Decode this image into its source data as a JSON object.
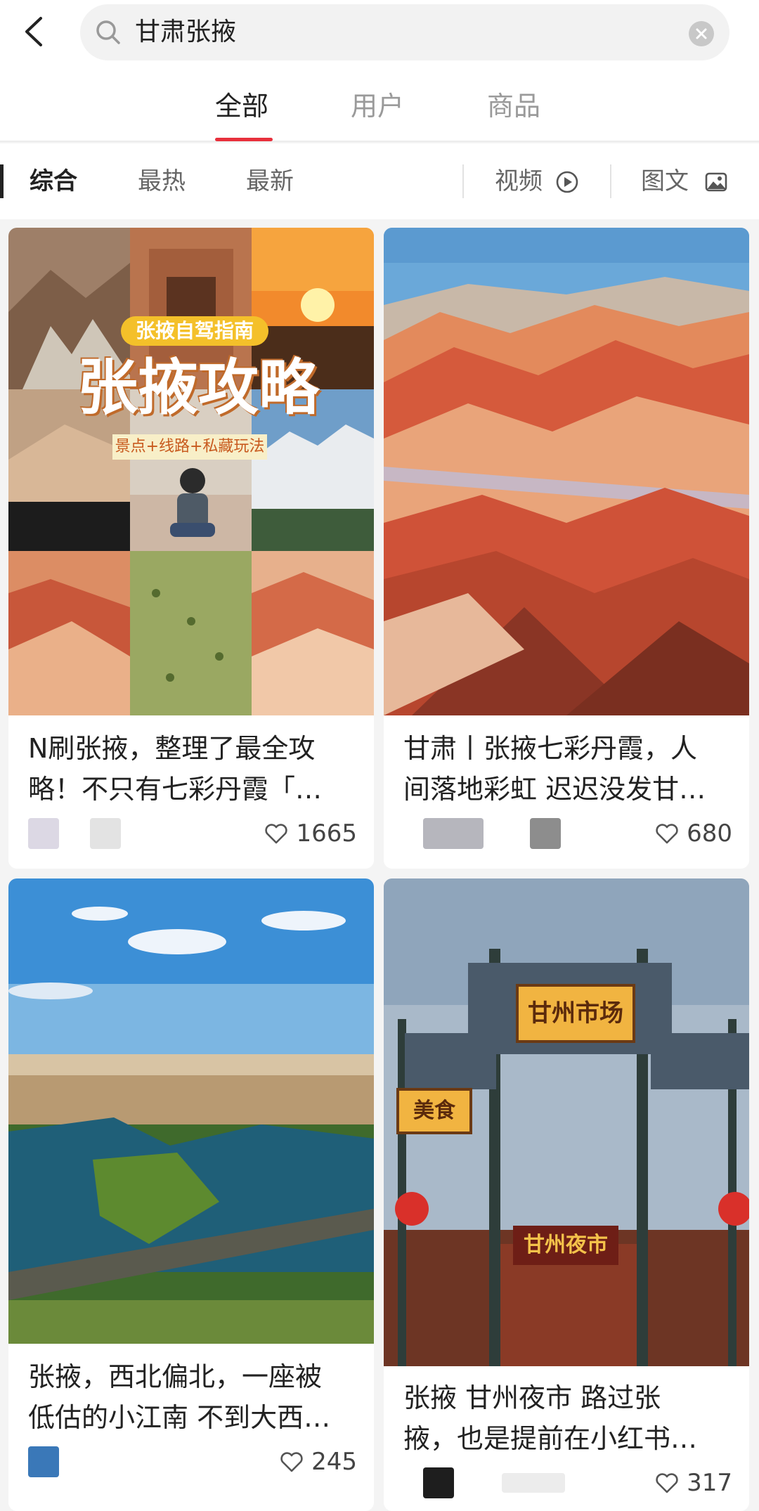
{
  "search": {
    "query": "甘肃张掖"
  },
  "tabs": [
    {
      "label": "全部"
    },
    {
      "label": "用户"
    },
    {
      "label": "商品"
    }
  ],
  "filters": {
    "items": [
      "综合",
      "最热",
      "最新"
    ],
    "video": "视频",
    "image_text": "图文"
  },
  "cards": [
    {
      "title_line1": "N刷张掖，整理了最全攻",
      "title_line2": "略！不只有七彩丹霞「…",
      "likes": "1665",
      "overlay_top": "张掖自驾指南",
      "overlay_main": "张掖攻略",
      "overlay_sub": "景点+线路+私藏玩法"
    },
    {
      "title_line1": "甘肃丨张掖七彩丹霞，人",
      "title_line2": "间落地彩虹 迟迟没发甘…",
      "likes": "680"
    },
    {
      "title_line1": "张掖，西北偏北，一座被",
      "title_line2": "低估的小江南 不到大西…",
      "likes": "245"
    },
    {
      "title_line1": "张掖 甘州夜市 路过张",
      "title_line2": "掖，也是提前在小红书…",
      "likes": "317",
      "sign_main": "甘州市场",
      "sign_left": "美食",
      "sign_night": "甘州夜市"
    }
  ],
  "colors": {
    "accent": "#e8303c"
  }
}
